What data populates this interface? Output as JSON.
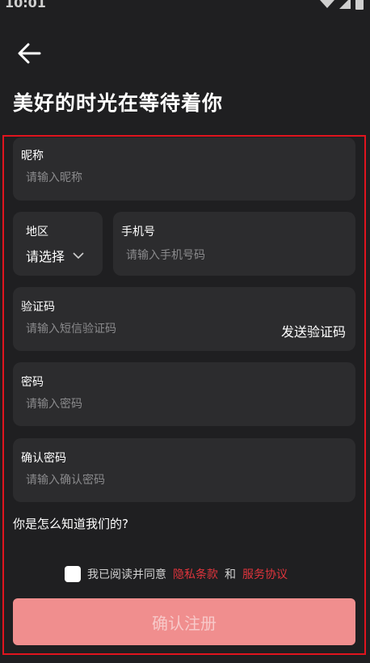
{
  "status_bar": {
    "time": "10:01"
  },
  "header": {
    "title": "美好的时光在等待着你"
  },
  "form": {
    "nickname": {
      "label": "昵称",
      "placeholder": "请输入昵称"
    },
    "region": {
      "label": "地区",
      "value": "请选择"
    },
    "phone": {
      "label": "手机号",
      "placeholder": "请输入手机号码"
    },
    "code": {
      "label": "验证码",
      "placeholder": "请输入短信验证码",
      "send_label": "发送验证码"
    },
    "password": {
      "label": "密码",
      "placeholder": "请输入密码"
    },
    "confirm_password": {
      "label": "确认密码",
      "placeholder": "请输入确认密码"
    },
    "how_know": "你是怎么知道我们的?"
  },
  "agreement": {
    "prefix": "我已阅读并同意",
    "privacy": "隐私条款",
    "and": "和",
    "service": "服务协议"
  },
  "submit": {
    "label": "确认注册"
  },
  "colors": {
    "background": "#1f1f21",
    "field": "#2c2c2e",
    "highlight_border": "#e0141e",
    "link": "#e0343c",
    "button": "#f08e8e"
  }
}
